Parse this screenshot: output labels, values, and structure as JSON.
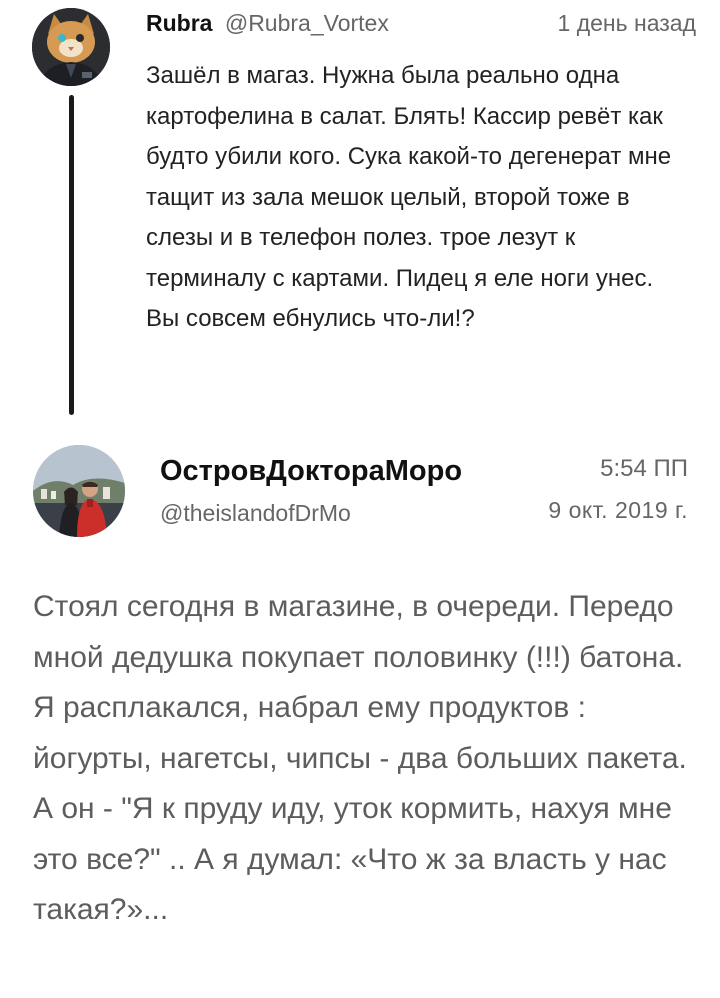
{
  "reply": {
    "avatar_icon": "cat-avatar-icon",
    "name": "Rubra",
    "handle": "@Rubra_Vortex",
    "time": "1 день назад",
    "text": "Зашёл в магаз. Нужна была реально одна картофелина в салат. Блять! Кассир ревёт как будто убили кого. Сука какой-то дегенерат мне тащит из зала мешок целый, второй тоже в слезы и в телефон полез. трое лезут к терминалу с картами. Пидец я еле ноги унес. Вы совсем ебнулись что-ли!?"
  },
  "tweet": {
    "avatar_icon": "couple-photo-avatar-icon",
    "name": "ОстровДоктораМоро",
    "handle": "@theislandofDrMo",
    "time": "5:54 ПП",
    "date": "9 окт. 2019 г.",
    "text": "Стоял сегодня в магазине, в очереди. Передо мной дедушка покупает половинку (!!!) батона. Я расплакался, набрал ему продуктов : йогурты, нагетсы, чипсы - два больших пакета. А он - \"Я к пруду иду, уток кормить, нахуя мне это все?\" .. А я думал: «Что ж за власть у нас такая?»..."
  },
  "colors": {
    "background": "#ffffff",
    "name": "#111111",
    "secondary": "#666666",
    "reply_text": "#222222",
    "tweet_text": "#5d5d5d",
    "thread_line": "#1a1a1a"
  }
}
